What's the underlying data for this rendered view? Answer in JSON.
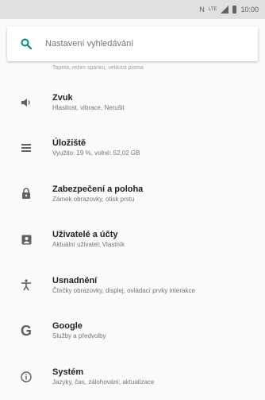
{
  "status_bar": {
    "network": "N",
    "signal_label": "LTE",
    "time": "10:00"
  },
  "search": {
    "placeholder": "Nastavení vyhledávání"
  },
  "scrolled_item_subtitle": "Tapeta, režim spánku, velikost písma",
  "items": [
    {
      "title": "Zvuk",
      "subtitle": "Hlasitost, vibrace, Nerušit",
      "icon": "volume-icon"
    },
    {
      "title": "Úložiště",
      "subtitle": "Využito: 19 %, volné: 52,02 GB",
      "icon": "storage-icon"
    },
    {
      "title": "Zabezpečení a poloha",
      "subtitle": "Zámek obrazovky, otisk prstu",
      "icon": "lock-icon"
    },
    {
      "title": "Uživatelé a účty",
      "subtitle": "Aktuální uživatel: Vlastník",
      "icon": "account-icon"
    },
    {
      "title": "Usnadnění",
      "subtitle": "Čtečky obrazovky, displej, ovládací prvky interakce",
      "icon": "accessibility-icon"
    },
    {
      "title": "Google",
      "subtitle": "Služby a předvolby",
      "icon": "google-icon"
    },
    {
      "title": "Systém",
      "subtitle": "Jazyky, čas, zálohování, aktualizace",
      "icon": "info-icon"
    }
  ],
  "colors": {
    "accent": "#00897b",
    "icon": "#616161",
    "status_bar": "#e0e0e0"
  }
}
